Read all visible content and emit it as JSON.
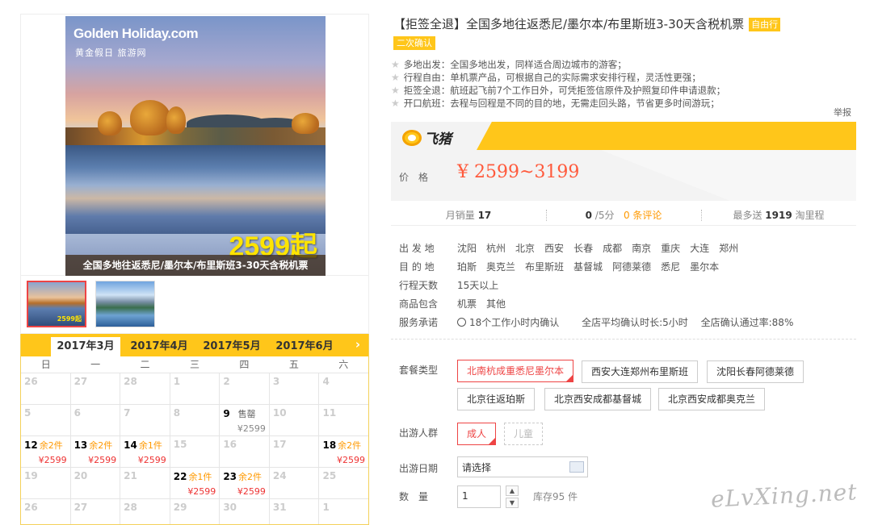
{
  "main_image": {
    "logo": "Golden Holiday.com",
    "logo_sub": "黄金假日 旅游网",
    "price_text": "2599起",
    "caption": "全国多地往返悉尼/墨尔本/布里斯班3-30天含税机票"
  },
  "thumbs": [
    {
      "price_text": "2599起"
    },
    {
      "price_text": ""
    }
  ],
  "calendar": {
    "tabs": [
      "2017年3月",
      "2017年4月",
      "2017年5月",
      "2017年6月"
    ],
    "active_tab": 0,
    "next_icon": "chevron-right-icon",
    "weekdays": [
      "日",
      "一",
      "二",
      "三",
      "四",
      "五",
      "六"
    ],
    "rows": [
      [
        {
          "d": "26"
        },
        {
          "d": "27"
        },
        {
          "d": "28"
        },
        {
          "d": "1"
        },
        {
          "d": "2"
        },
        {
          "d": "3"
        },
        {
          "d": "4"
        }
      ],
      [
        {
          "d": "5"
        },
        {
          "d": "6"
        },
        {
          "d": "7"
        },
        {
          "d": "8"
        },
        {
          "d": "9",
          "on": true,
          "sold": "售罄",
          "price": "¥2599",
          "grey": true
        },
        {
          "d": "10"
        },
        {
          "d": "11"
        }
      ],
      [
        {
          "d": "12",
          "on": true,
          "rem": "余2件",
          "price": "¥2599"
        },
        {
          "d": "13",
          "on": true,
          "rem": "余2件",
          "price": "¥2599"
        },
        {
          "d": "14",
          "on": true,
          "rem": "余1件",
          "price": "¥2599"
        },
        {
          "d": "15"
        },
        {
          "d": "16"
        },
        {
          "d": "17"
        },
        {
          "d": "18",
          "on": true,
          "rem": "余2件",
          "price": "¥2599"
        }
      ],
      [
        {
          "d": "19"
        },
        {
          "d": "20"
        },
        {
          "d": "21"
        },
        {
          "d": "22",
          "on": true,
          "rem": "余1件",
          "price": "¥2599"
        },
        {
          "d": "23",
          "on": true,
          "rem": "余2件",
          "price": "¥2599"
        },
        {
          "d": "24"
        },
        {
          "d": "25"
        }
      ],
      [
        {
          "d": "26"
        },
        {
          "d": "27"
        },
        {
          "d": "28"
        },
        {
          "d": "29"
        },
        {
          "d": "30"
        },
        {
          "d": "31"
        },
        {
          "d": "1"
        }
      ]
    ]
  },
  "product": {
    "title": "【拒签全退】全国多地往返悉尼/墨尔本/布里斯班3-30天含税机票",
    "tag_free": "自由行",
    "tag_confirm": "二次确认",
    "features": [
      "多地出发：全国多地出发，同样适合周边城市的游客；",
      "行程自由：单机票产品，可根据自己的实际需求安排行程，灵活性更强；",
      "拒签全退：航班起飞前7个工作日外，可凭拒签信原件及护照复印件申请退款；",
      "开口航班：去程与回程是不同的目的地，无需走回头路，节省更多时间游玩；"
    ],
    "report": "举报",
    "brand": "飞猪",
    "price_label": "价格",
    "price": "¥ 2599~3199",
    "stats": {
      "monthly_sales_label": "月销量",
      "monthly_sales": "17",
      "rating": "0",
      "rating_suffix": "/5分",
      "reviews": "0 条评论",
      "points_label": "最多送",
      "points": "1919",
      "points_suffix": "淘里程"
    },
    "info": {
      "depart_label": "出 发 地",
      "depart": [
        "沈阳",
        "杭州",
        "北京",
        "西安",
        "长春",
        "成都",
        "南京",
        "重庆",
        "大连",
        "郑州"
      ],
      "dest_label": "目 的 地",
      "dest": [
        "珀斯",
        "奥克兰",
        "布里斯班",
        "基督城",
        "阿德莱德",
        "悉尼",
        "墨尔本"
      ],
      "days_label": "行程天数",
      "days": "15天以上",
      "includes_label": "商品包含",
      "includes": [
        "机票",
        "其他"
      ],
      "promise_label": "服务承诺",
      "promise": [
        "18个工作小时内确认",
        "全店平均确认时长:5小时",
        "全店确认通过率:88%"
      ]
    },
    "options": {
      "package_label": "套餐类型",
      "packages": [
        "北南杭成重悉尼墨尔本",
        "西安大连郑州布里斯班",
        "沈阳长春阿德莱德",
        "北京往返珀斯",
        "北京西安成都基督城",
        "北京西安成都奥克兰"
      ],
      "selected_package": 0,
      "group_label": "出游人群",
      "groups": [
        "成人",
        "儿童"
      ],
      "date_label": "出游日期",
      "date_value": "请选择",
      "qty_label": "数量",
      "qty_value": "1",
      "stock": "库存95 件"
    }
  },
  "watermark": "eLvXing.net"
}
